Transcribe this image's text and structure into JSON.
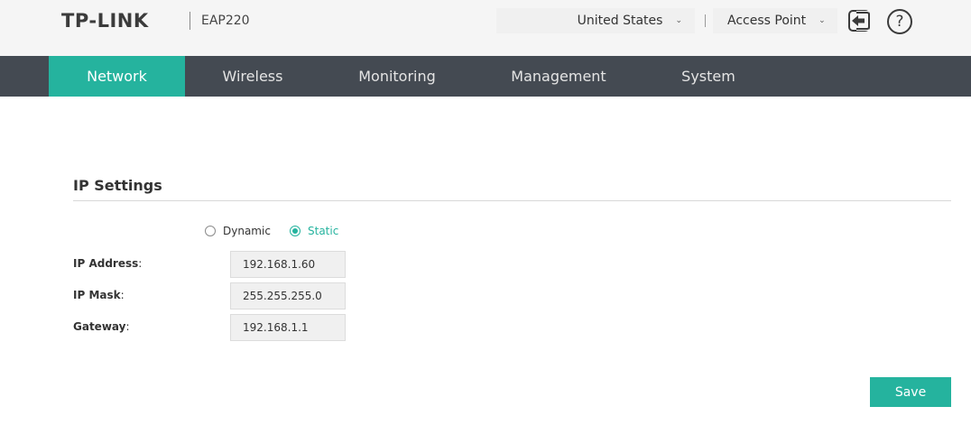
{
  "header": {
    "brand": "TP-LINK",
    "model": "EAP220",
    "country_select": {
      "value": "United States",
      "options": [
        "United States"
      ]
    },
    "mode_select": {
      "value": "Access Point",
      "options": [
        "Access Point"
      ]
    },
    "icons": {
      "logout": "logout-icon",
      "help": "help-icon"
    },
    "help_glyph": "?"
  },
  "nav": {
    "tabs": [
      {
        "label": "Network",
        "active": true
      },
      {
        "label": "Wireless",
        "active": false
      },
      {
        "label": "Monitoring",
        "active": false
      },
      {
        "label": "Management",
        "active": false
      },
      {
        "label": "System",
        "active": false
      }
    ]
  },
  "ip_settings": {
    "title": "IP Settings",
    "mode_options": [
      {
        "label": "Dynamic",
        "checked": false
      },
      {
        "label": "Static",
        "checked": true
      }
    ],
    "fields": [
      {
        "label": "IP Address",
        "value": "192.168.1.60"
      },
      {
        "label": "IP Mask",
        "value": "255.255.255.0"
      },
      {
        "label": "Gateway",
        "value": "192.168.1.1"
      }
    ],
    "label_suffix": ":"
  },
  "actions": {
    "save_label": "Save"
  },
  "colors": {
    "accent": "#25b39e",
    "nav_background": "#444a52",
    "header_background": "#f5f5f5"
  }
}
